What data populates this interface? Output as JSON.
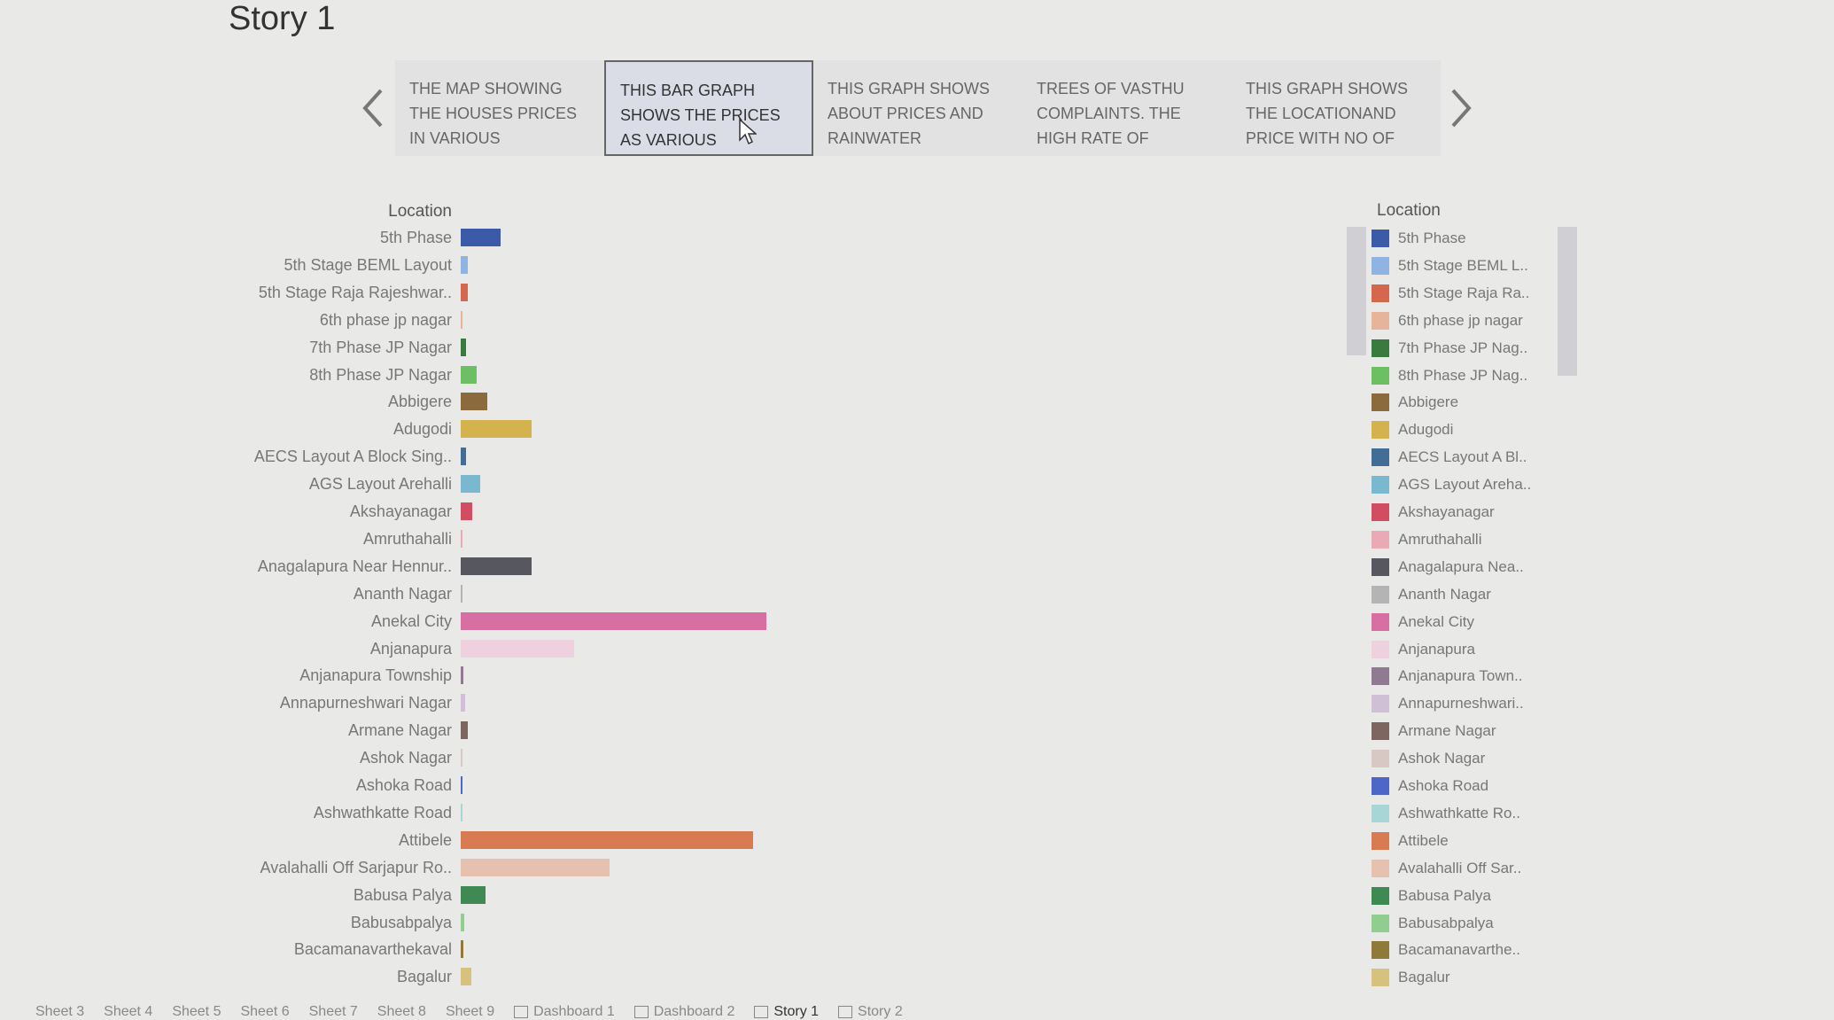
{
  "story": {
    "title": "Story 1",
    "captions": [
      "THE MAP SHOWING THE HOUSES PRICES IN VARIOUS",
      "THIS BAR GRAPH SHOWS THE PRICES AS VARIOUS",
      "THIS GRAPH SHOWS ABOUT PRICES AND RAINWATER",
      "TREES OF VASTHU COMPLAINTS. THE HIGH RATE OF",
      "THIS GRAPH SHOWS THE LOCATIONAND PRICE WITH NO OF"
    ],
    "active_caption": 1
  },
  "chart_data": {
    "type": "bar",
    "orientation": "horizontal",
    "title": "Location",
    "categories": [
      "5th Phase",
      "5th Stage BEML Layout",
      "5th Stage Raja Rajeshwar..",
      "6th phase jp nagar",
      "7th Phase JP Nagar",
      "8th Phase JP Nagar",
      "Abbigere",
      "Adugodi",
      "AECS Layout A Block Sing..",
      "AGS Layout Arehalli",
      "Akshayanagar",
      "Amruthahalli",
      "Anagalapura Near Hennur..",
      "Ananth Nagar",
      "Anekal City",
      "Anjanapura",
      "Anjanapura Township",
      "Annapurneshwari Nagar",
      "Armane Nagar",
      "Ashok Nagar",
      "Ashoka Road",
      "Ashwathkatte Road",
      "Attibele",
      "Avalahalli Off Sarjapur Ro..",
      "Babusa Palya",
      "Babusabpalya",
      "Bacamanavarthekaval",
      "Bagalur"
    ],
    "values": [
      45,
      8,
      8,
      2,
      6,
      18,
      30,
      80,
      6,
      22,
      13,
      1,
      80,
      1,
      345,
      128,
      3,
      5,
      8,
      2,
      1,
      2,
      330,
      168,
      28,
      4,
      3,
      12
    ],
    "colors": [
      "#3b5aa8",
      "#8fb4e3",
      "#d6674f",
      "#e6b49a",
      "#3b7a3f",
      "#6cbf62",
      "#8b6a3e",
      "#d4b24e",
      "#416d96",
      "#7ab8cf",
      "#d14d62",
      "#e9a9b5",
      "#57575f",
      "#b4b4b4",
      "#d86fa2",
      "#efd0df",
      "#8f7a92",
      "#cfc0d6",
      "#7d6660",
      "#d8c8c4",
      "#4f66c9",
      "#a8d6d6",
      "#d87a52",
      "#e7c1b0",
      "#3f8a52",
      "#8fce8f",
      "#8f7a3a",
      "#d6c27e"
    ],
    "xlim": [
      0,
      400
    ],
    "grid": false,
    "legend_position": "right"
  },
  "legend": {
    "title": "Location",
    "items": [
      "5th Phase",
      "5th Stage BEML L..",
      "5th Stage Raja Ra..",
      "6th phase jp nagar",
      "7th Phase JP Nag..",
      "8th Phase JP Nag..",
      "Abbigere",
      "Adugodi",
      "AECS Layout A Bl..",
      "AGS Layout Areha..",
      "Akshayanagar",
      "Amruthahalli",
      "Anagalapura Nea..",
      "Ananth Nagar",
      "Anekal City",
      "Anjanapura",
      "Anjanapura Town..",
      "Annapurneshwari..",
      "Armane Nagar",
      "Ashok Nagar",
      "Ashoka Road",
      "Ashwathkatte Ro..",
      "Attibele",
      "Avalahalli Off Sar..",
      "Babusa Palya",
      "Babusabpalya",
      "Bacamanavarthe..",
      "Bagalur"
    ]
  },
  "sheet_tabs": [
    {
      "label": "Sheet 3",
      "icon": ""
    },
    {
      "label": "Sheet 4",
      "icon": ""
    },
    {
      "label": "Sheet 5",
      "icon": ""
    },
    {
      "label": "Sheet 6",
      "icon": ""
    },
    {
      "label": "Sheet 7",
      "icon": ""
    },
    {
      "label": "Sheet 8",
      "icon": ""
    },
    {
      "label": "Sheet 9",
      "icon": ""
    },
    {
      "label": "Dashboard 1",
      "icon": "dashboard-icon"
    },
    {
      "label": "Dashboard 2",
      "icon": "dashboard-icon"
    },
    {
      "label": "Story 1",
      "icon": "story-icon"
    },
    {
      "label": "Story 2",
      "icon": "story-icon"
    }
  ],
  "active_sheet": "Story 1"
}
